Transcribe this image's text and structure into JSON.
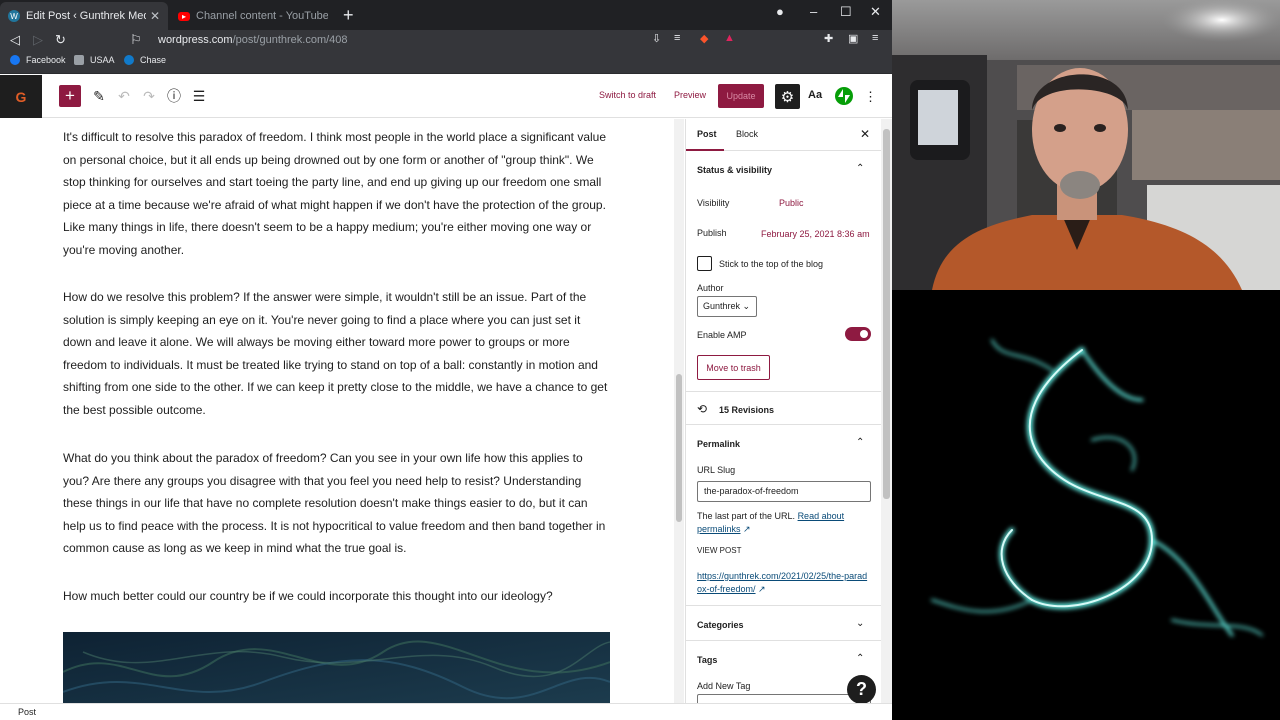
{
  "browser": {
    "tabs": [
      {
        "title": "Edit Post ‹ Gunthrek Media — W",
        "active": true
      },
      {
        "title": "Channel content - YouTube Studio",
        "active": false
      }
    ],
    "url_host": "wordpress.com",
    "url_path": "/post/gunthrek.com/408",
    "bookmarks": [
      "Facebook",
      "USAA",
      "Chase"
    ]
  },
  "toolbar": {
    "site_initial": "G",
    "switch_to_draft": "Switch to draft",
    "preview": "Preview",
    "update": "Update",
    "aa": "Aa"
  },
  "content": {
    "paragraphs": [
      "It's difficult to resolve this paradox of freedom.  I think most people in the world place a significant value on personal choice, but it all ends up being drowned out by one form or another of \"group think\".  We stop thinking for ourselves and start toeing the party line, and end up giving up our freedom one small piece at a time because we're afraid of what might happen if we don't have the protection of the group.  Like many things in life, there doesn't seem to be a happy medium; you're either moving one way or you're moving another.",
      "How do we resolve this problem?  If the answer were simple, it wouldn't still be an issue.  Part of the solution is simply keeping an eye on it.  You're never going to find a place where you can just set it down and leave it alone.  We will always be moving either toward more power to groups or more freedom to individuals.  It must be treated like trying to stand on top of a ball: constantly in motion and shifting from one side to the other.  If we can keep it pretty close to the middle, we have a chance to get the best possible outcome.",
      "What do you think about the paradox of freedom?  Can you see in your own life how this applies to you?  Are there any groups you disagree with that you feel you need help to resist?  Understanding these things in our life that have no complete resolution doesn't make things easier to do, but it can help us to find peace with the process.  It is not hypocritical to value freedom and then band together in common cause as long as we keep in mind what the true goal is.",
      "How much better could our country be if we could incorporate this thought into our ideology?"
    ]
  },
  "sidebar": {
    "tab_post": "Post",
    "tab_block": "Block",
    "status_heading": "Status & visibility",
    "visibility_label": "Visibility",
    "visibility_value": "Public",
    "publish_label": "Publish",
    "publish_value": "February 25, 2021 8:36 am",
    "sticky_label": "Stick to the top of the blog",
    "author_label": "Author",
    "author_value": "Gunthrek",
    "amp_label": "Enable AMP",
    "trash_label": "Move to trash",
    "revisions": "15 Revisions",
    "permalink_heading": "Permalink",
    "url_slug_label": "URL Slug",
    "url_slug_value": "the-paradox-of-freedom",
    "help_text": "The last part of the URL.",
    "help_link": "Read about permalinks",
    "view_post_label": "VIEW POST",
    "view_post_url": "https://gunthrek.com/2021/02/25/the-paradox-of-freedom/",
    "categories_heading": "Categories",
    "tags_heading": "Tags",
    "add_tag_label": "Add New Tag"
  },
  "footer": {
    "breadcrumb": "Post"
  },
  "colors": {
    "accent": "#8e1a41",
    "dark": "#1e1e1e",
    "chrome": "#35363a"
  }
}
